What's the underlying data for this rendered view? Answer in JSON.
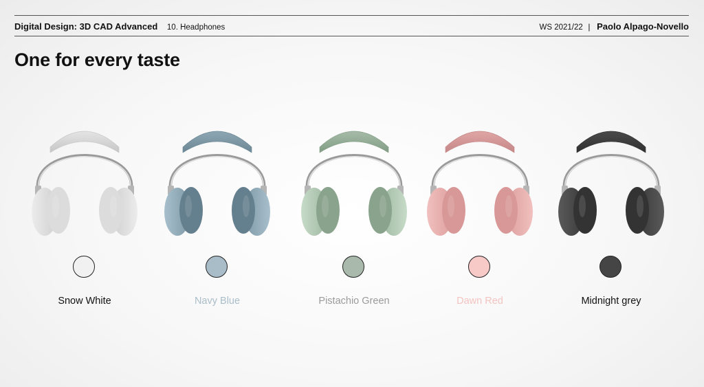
{
  "header": {
    "course": "Digital Design: 3D CAD Advanced",
    "topic": "10. Headphones",
    "semester": "WS 2021/22",
    "separator": "|",
    "author": "Paolo Alpago-Novello"
  },
  "title": "One for every taste",
  "variants": [
    {
      "name": "Snow White",
      "swatch": "#f1f1f1",
      "label_color": "#111111",
      "band": "#e4e4e4",
      "band_dark": "#c6c6c6",
      "cup": "#ececec",
      "cup_shade": "#cfcfcf",
      "cushion": "#dcdcdc"
    },
    {
      "name": "Navy Blue",
      "swatch": "#a9bdc8",
      "label_color": "#a9bdc8",
      "band": "#8ea7b4",
      "band_dark": "#6b8694",
      "cup": "#a8c0cc",
      "cup_shade": "#7e98a6",
      "cushion": "#647f8d"
    },
    {
      "name": "Pistachio Green",
      "swatch": "#a9b9ab",
      "label_color": "#9a9a9a",
      "band": "#a6bca8",
      "band_dark": "#819c84",
      "cup": "#c7dcc8",
      "cup_shade": "#9fb8a2",
      "cushion": "#8aa38d"
    },
    {
      "name": "Dawn Red",
      "swatch": "#f7c9c7",
      "label_color": "#f3c4c2",
      "band": "#e0a5a5",
      "band_dark": "#c58787",
      "cup": "#f1c0be",
      "cup_shade": "#dc9f9e",
      "cushion": "#d99898"
    },
    {
      "name": "Midnight grey",
      "swatch": "#454545",
      "label_color": "#111111",
      "band": "#4a4a4a",
      "band_dark": "#303030",
      "cup": "#5a5a5a",
      "cup_shade": "#3a3a3a",
      "cushion": "#333333"
    }
  ]
}
